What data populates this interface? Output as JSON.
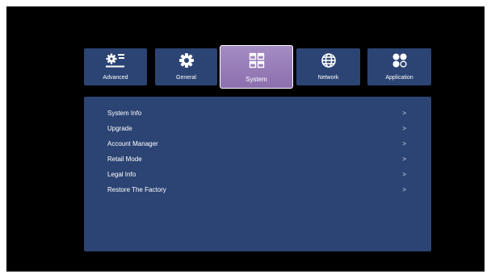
{
  "tabs": [
    {
      "label": "Advanced",
      "icon": "gear-sliders-icon",
      "active": false
    },
    {
      "label": "General",
      "icon": "gear-icon",
      "active": false
    },
    {
      "label": "System",
      "icon": "windows-grid-icon",
      "active": true
    },
    {
      "label": "Network",
      "icon": "globe-icon",
      "active": false
    },
    {
      "label": "Application",
      "icon": "apps-icon",
      "active": false
    }
  ],
  "menu": {
    "items": [
      {
        "label": "System Info",
        "chevron": ">"
      },
      {
        "label": "Upgrade",
        "chevron": ">"
      },
      {
        "label": "Account Manager",
        "chevron": ">"
      },
      {
        "label": "Retail Mode",
        "chevron": ">"
      },
      {
        "label": "Legal Info",
        "chevron": ">"
      },
      {
        "label": "Restore The Factory",
        "chevron": ">"
      }
    ]
  },
  "colors": {
    "background": "#000000",
    "tab": "#2c4474",
    "tab_active": "#9b82ba",
    "panel": "#2c4474",
    "text": "#ffffff"
  }
}
